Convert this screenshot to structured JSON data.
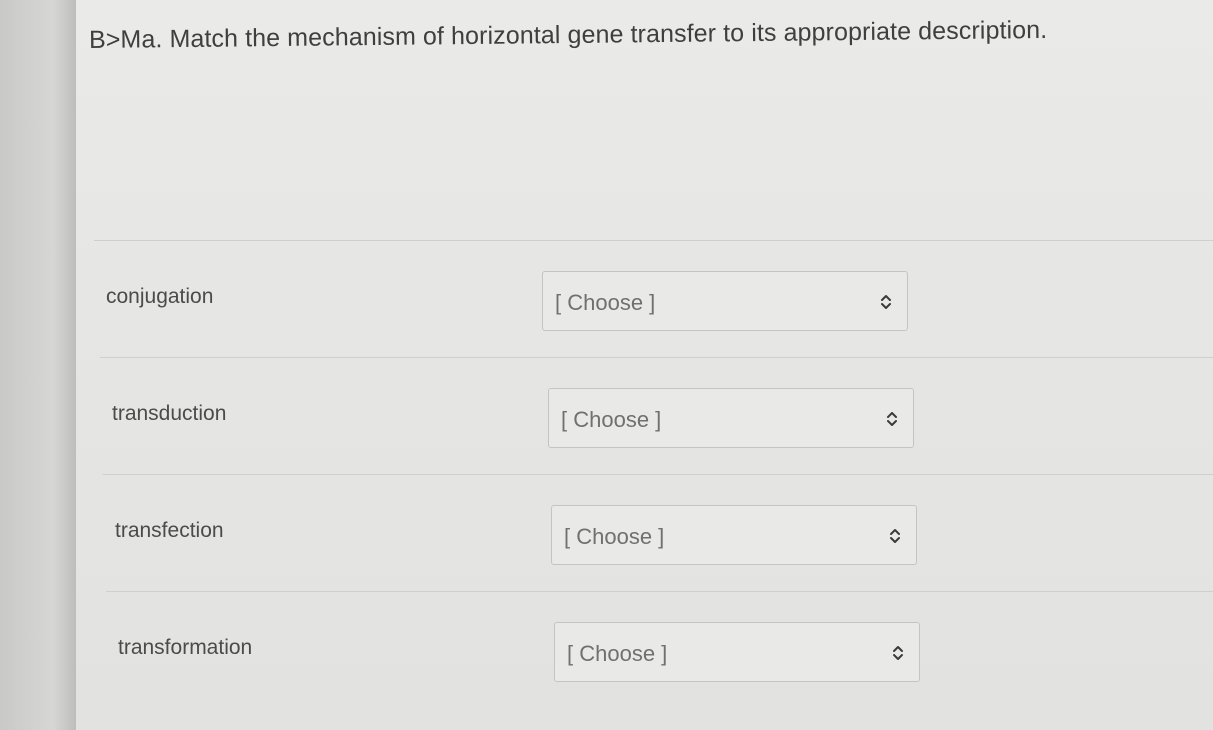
{
  "question": {
    "title": "B>Ma. Match the mechanism of horizontal gene transfer to its appropriate description."
  },
  "rows": [
    {
      "term": "conjugation",
      "select_value": "[ Choose ]"
    },
    {
      "term": "transduction",
      "select_value": "[ Choose ]"
    },
    {
      "term": "transfection",
      "select_value": "[ Choose ]"
    },
    {
      "term": "transformation",
      "select_value": "[ Choose ]"
    }
  ],
  "icons": {
    "select_chevron": "chevron-up-down-icon"
  }
}
